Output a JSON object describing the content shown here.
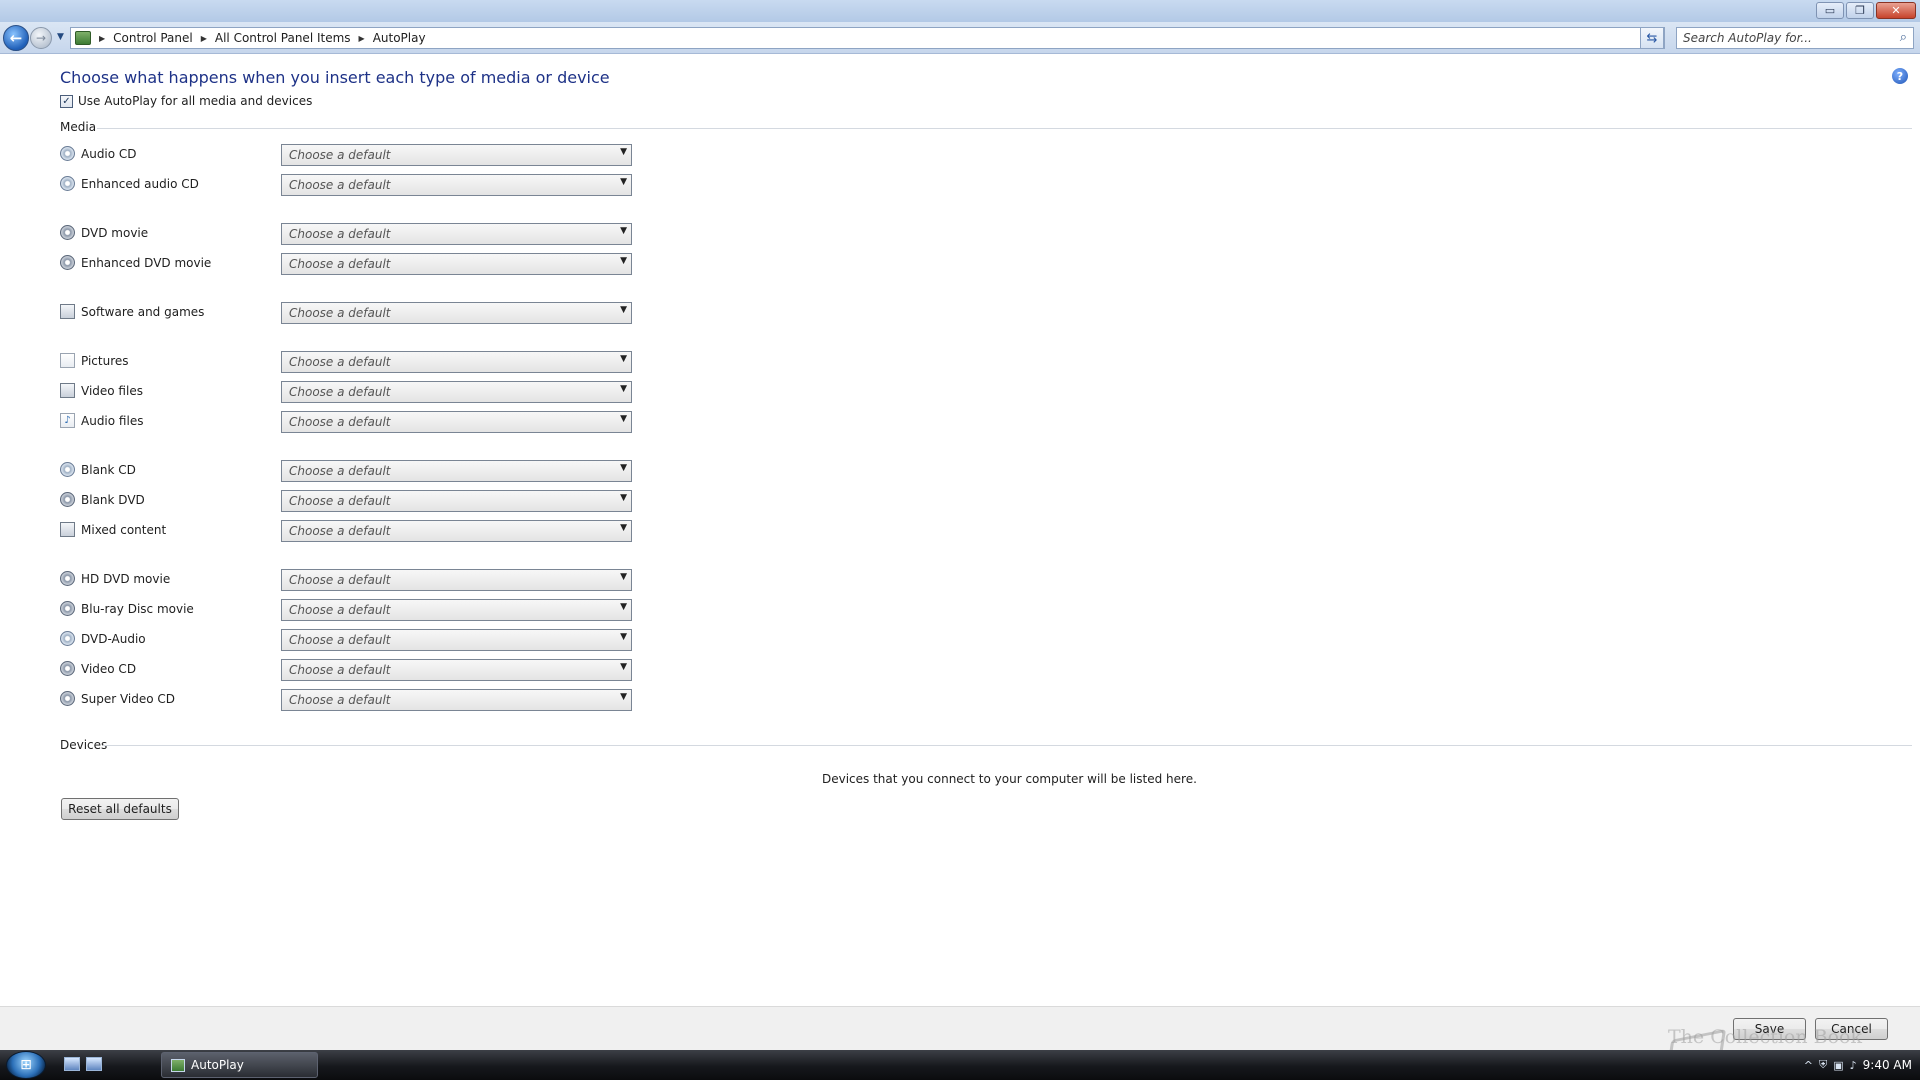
{
  "titlebar": {
    "min_symbol": "▭",
    "restore_symbol": "❐",
    "close_symbol": "✕"
  },
  "address": {
    "crumbs": [
      "Control Panel",
      "All Control Panel Items",
      "AutoPlay"
    ],
    "search_placeholder": "Search AutoPlay for..."
  },
  "content": {
    "title": "Choose what happens when you insert each type of media or device",
    "master_checkbox_label": "Use AutoPlay for all media and devices",
    "master_checked": true,
    "media_heading": "Media",
    "select_placeholder": "Choose a default",
    "media_items": [
      {
        "label": "Audio CD",
        "icon": "cd-icon"
      },
      {
        "label": "Enhanced audio CD",
        "icon": "cd-icon"
      },
      {
        "label": "DVD movie",
        "icon": "dvd-icon"
      },
      {
        "label": "Enhanced DVD movie",
        "icon": "dvd-icon"
      },
      {
        "label": "Software and games",
        "icon": "software-icon"
      },
      {
        "label": "Pictures",
        "icon": "pictures-icon"
      },
      {
        "label": "Video files",
        "icon": "video-file-icon"
      },
      {
        "label": "Audio files",
        "icon": "audio-file-icon"
      },
      {
        "label": "Blank CD",
        "icon": "blank-cd-icon"
      },
      {
        "label": "Blank DVD",
        "icon": "blank-dvd-icon"
      },
      {
        "label": "Mixed content",
        "icon": "mixed-content-icon"
      },
      {
        "label": "HD DVD movie",
        "icon": "dvd-icon"
      },
      {
        "label": "Blu-ray Disc movie",
        "icon": "dvd-icon"
      },
      {
        "label": "DVD-Audio",
        "icon": "cd-icon"
      },
      {
        "label": "Video CD",
        "icon": "dvd-icon"
      },
      {
        "label": "Super Video CD",
        "icon": "dvd-icon"
      }
    ],
    "devices_heading": "Devices",
    "devices_message": "Devices that you connect to your computer will be listed here.",
    "reset_button": "Reset all defaults"
  },
  "footer": {
    "save_button": "Save",
    "cancel_button": "Cancel"
  },
  "taskbar": {
    "task_label": "AutoPlay",
    "clock": "9:40 AM",
    "watermark": "The Collection Book"
  }
}
